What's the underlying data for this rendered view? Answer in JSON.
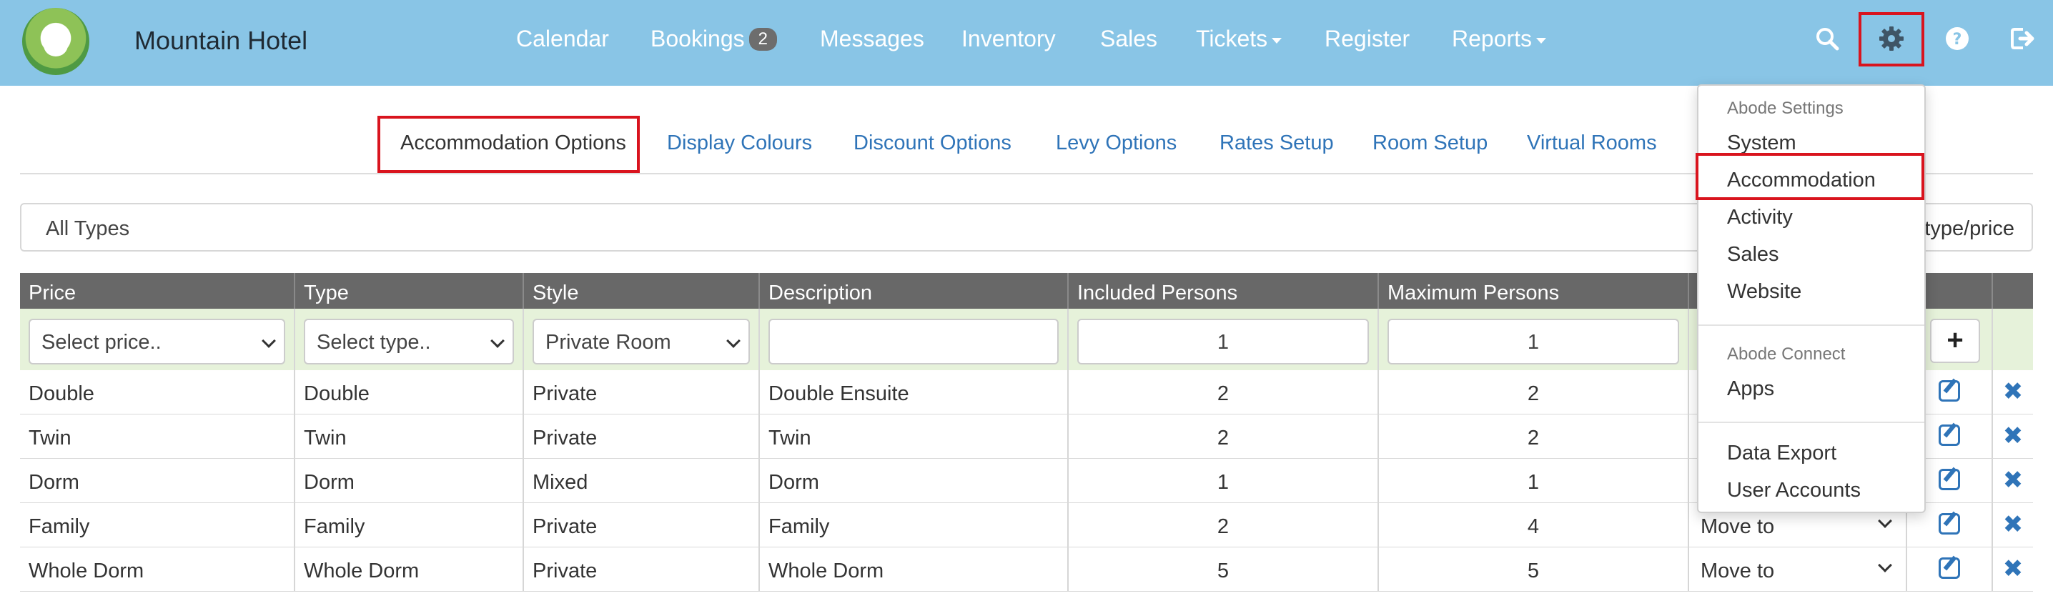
{
  "app": {
    "title": "Mountain Hotel"
  },
  "nav": {
    "calendar": "Calendar",
    "bookings": "Bookings",
    "bookings_badge": "2",
    "messages": "Messages",
    "inventory": "Inventory",
    "sales": "Sales",
    "tickets": "Tickets",
    "register": "Register",
    "reports": "Reports"
  },
  "tabs": {
    "accommodation_options": "Accommodation Options",
    "display_colours": "Display Colours",
    "discount_options": "Discount Options",
    "levy_options": "Levy Options",
    "rates_setup": "Rates Setup",
    "room_setup": "Room Setup",
    "virtual_rooms": "Virtual Rooms"
  },
  "filter": {
    "value": "All Types",
    "right_text": "type/price"
  },
  "table": {
    "headers": {
      "price": "Price",
      "type": "Type",
      "style": "Style",
      "description": "Description",
      "included": "Included Persons",
      "maximum": "Maximum Persons"
    },
    "add_row": {
      "price_select": "Select price..",
      "type_select": "Select type..",
      "style_select": "Private Room",
      "description": "",
      "included": "1",
      "maximum": "1"
    },
    "rows": [
      {
        "price": "Double",
        "type": "Double",
        "style": "Private",
        "description": "Double Ensuite",
        "included": "2",
        "maximum": "2",
        "move": ""
      },
      {
        "price": "Twin",
        "type": "Twin",
        "style": "Private",
        "description": "Twin",
        "included": "2",
        "maximum": "2",
        "move": ""
      },
      {
        "price": "Dorm",
        "type": "Dorm",
        "style": "Mixed",
        "description": "Dorm",
        "included": "1",
        "maximum": "1",
        "move": ""
      },
      {
        "price": "Family",
        "type": "Family",
        "style": "Private",
        "description": "Family",
        "included": "2",
        "maximum": "4",
        "move": "Move to"
      },
      {
        "price": "Whole Dorm",
        "type": "Whole Dorm",
        "style": "Private",
        "description": "Whole Dorm",
        "included": "5",
        "maximum": "5",
        "move": "Move to"
      }
    ]
  },
  "settings_menu": {
    "header_settings": "Abode Settings",
    "system": "System",
    "accommodation": "Accommodation",
    "activity": "Activity",
    "sales": "Sales",
    "website": "Website",
    "header_connect": "Abode Connect",
    "apps": "Apps",
    "data_export": "Data Export",
    "user_accounts": "User Accounts"
  },
  "icons": {
    "search": "search-icon",
    "settings": "gear-icon",
    "help": "question-circle-icon",
    "logout": "sign-out-icon",
    "add": "plus-icon",
    "edit": "edit-icon",
    "delete": "close-icon"
  },
  "colors": {
    "navbar": "#89c5e6",
    "link": "#2f74b8",
    "highlight": "#d9141e",
    "table_header": "#686868"
  }
}
